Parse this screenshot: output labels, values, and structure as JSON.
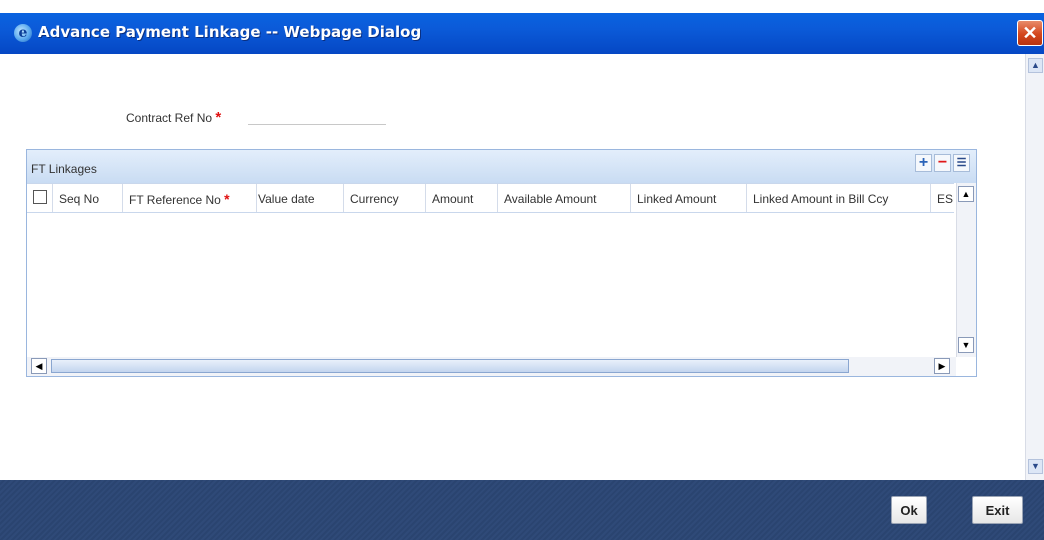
{
  "window": {
    "title": "Advance Payment Linkage -- Webpage Dialog",
    "close_glyph": "✕",
    "title_icon": "e"
  },
  "form": {
    "contract_ref_label": "Contract Ref No",
    "required_marker": "*",
    "contract_ref_value": ""
  },
  "linkages": {
    "title": "FT Linkages",
    "toolbar": {
      "add_icon": "plus-icon",
      "delete_icon": "minus-icon",
      "single_view_icon": "list-icon"
    },
    "columns": [
      "Seq No",
      "FT Reference No",
      "Value date",
      "Currency",
      "Amount",
      "Available Amount",
      "Linked Amount",
      "Linked Amount in Bill Ccy",
      "ESN"
    ],
    "required_column": "FT Reference No",
    "rows": []
  },
  "footer": {
    "ok_label": "Ok",
    "exit_label": "Exit"
  },
  "colors": {
    "titlebar": "#0b5ad8",
    "grid_header": "#c9dcf3",
    "footer": "#2f4a78",
    "required": "#e01010",
    "close": "#d4461d"
  }
}
